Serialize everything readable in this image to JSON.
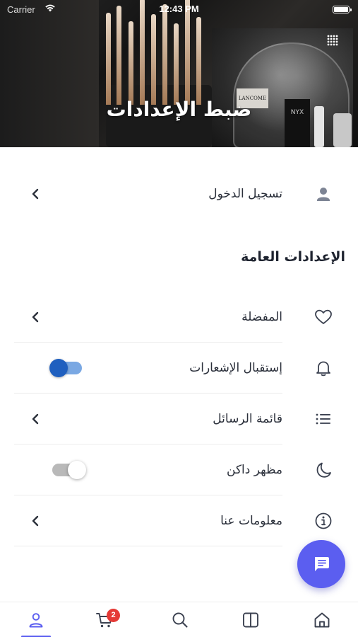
{
  "status_bar": {
    "carrier": "Carrier",
    "time": "12:43 PM"
  },
  "header": {
    "title": "ضبط الإعدادات",
    "image_brand_text": "LANCOME",
    "image_brand_text_2": "NYX"
  },
  "login_row": {
    "label": "تسجيل الدخول",
    "icon": "user-icon"
  },
  "general_settings": {
    "title": "الإعدادات العامة",
    "items": [
      {
        "label": "المفضلة",
        "icon": "heart-icon",
        "control": "chevron"
      },
      {
        "label": "إستقبال الإشعارات",
        "icon": "bell-icon",
        "control": "toggle",
        "enabled": true
      },
      {
        "label": "قائمة الرسائل",
        "icon": "list-icon",
        "control": "chevron"
      },
      {
        "label": "مظهر داكن",
        "icon": "moon-icon",
        "control": "toggle",
        "enabled": false
      },
      {
        "label": "معلومات عنا",
        "icon": "info-icon",
        "control": "chevron"
      }
    ]
  },
  "chat_fab": {
    "icon": "chat-icon"
  },
  "bottom_nav": {
    "items": [
      {
        "icon": "profile-icon",
        "active": true
      },
      {
        "icon": "cart-icon",
        "badge": "2"
      },
      {
        "icon": "search-icon"
      },
      {
        "icon": "book-icon"
      },
      {
        "icon": "home-icon"
      }
    ]
  },
  "colors": {
    "accent": "#5b5ef0",
    "toggle_on_knob": "#1f5fbf",
    "toggle_on_track": "#7aa8e3",
    "badge": "#e53935"
  }
}
